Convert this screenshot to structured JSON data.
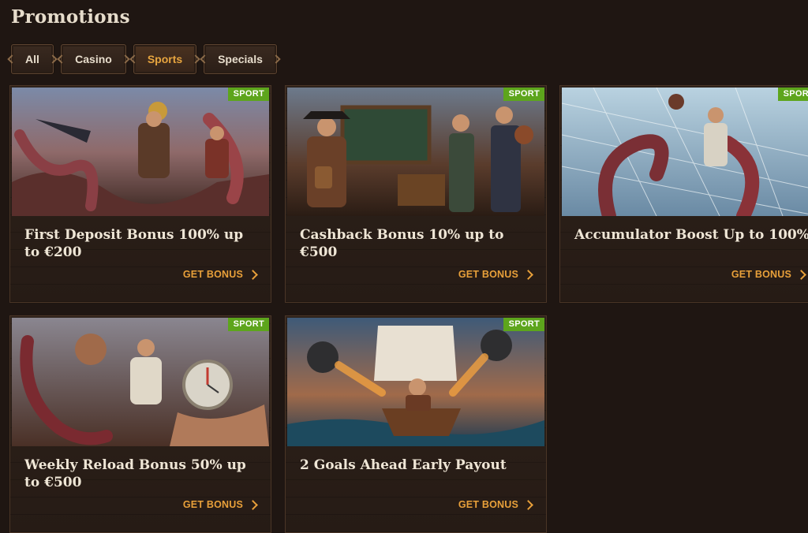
{
  "page": {
    "title": "Promotions"
  },
  "filters": [
    {
      "label": "All",
      "active": false
    },
    {
      "label": "Casino",
      "active": false
    },
    {
      "label": "Sports",
      "active": true
    },
    {
      "label": "Specials",
      "active": false
    }
  ],
  "cta_label": "GET BONUS",
  "badge_label": "SPORT",
  "cards": [
    {
      "title": "First Deposit Bonus 100% up to €200"
    },
    {
      "title": "Cashback Bonus 10% up to €500"
    },
    {
      "title": "Accumulator Boost Up to 100%"
    },
    {
      "title": "Weekly Reload Bonus 50% up to €500"
    },
    {
      "title": "2 Goals Ahead Early Payout"
    }
  ],
  "colors": {
    "accent": "#e8a03a",
    "badge": "#5da51c",
    "background": "#1f1612"
  }
}
